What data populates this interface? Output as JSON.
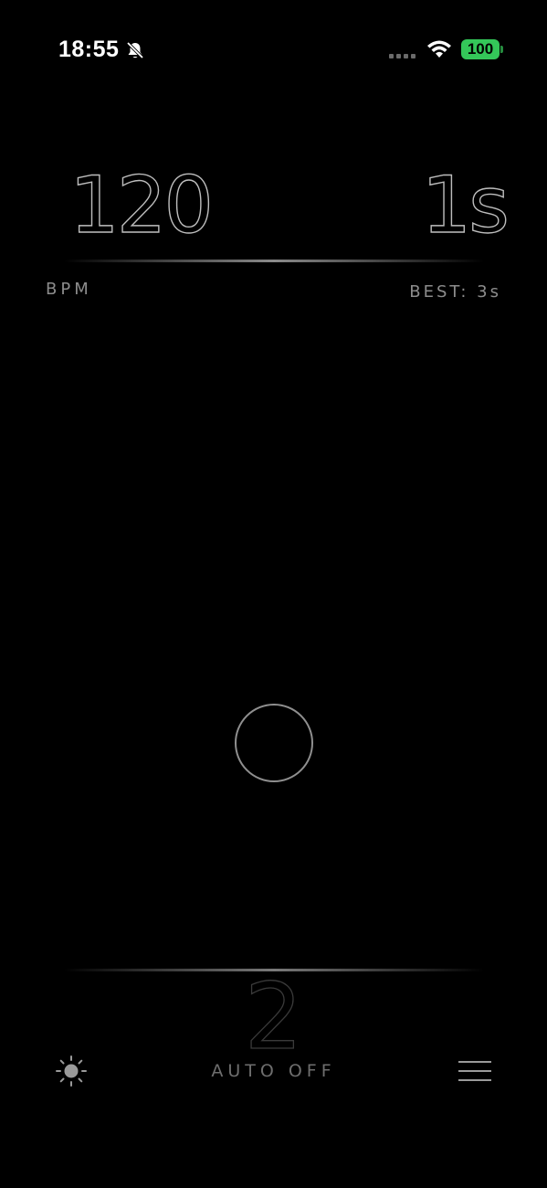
{
  "status_bar": {
    "time": "18:55",
    "battery": "100",
    "icons": [
      "silent-bell-icon",
      "cellular-dots-icon",
      "wifi-icon",
      "battery-icon"
    ],
    "battery_color": "#34c759"
  },
  "readouts": {
    "bpm_value": "120",
    "bpm_label": "BPM",
    "timer_value": "1s",
    "best_label": "BEST: 3s"
  },
  "tap": {
    "icon": "tap-circle"
  },
  "bottom": {
    "count_value": "2",
    "auto_label": "AUTO OFF",
    "left_icon": "brightness-icon",
    "right_icon": "menu-icon"
  }
}
